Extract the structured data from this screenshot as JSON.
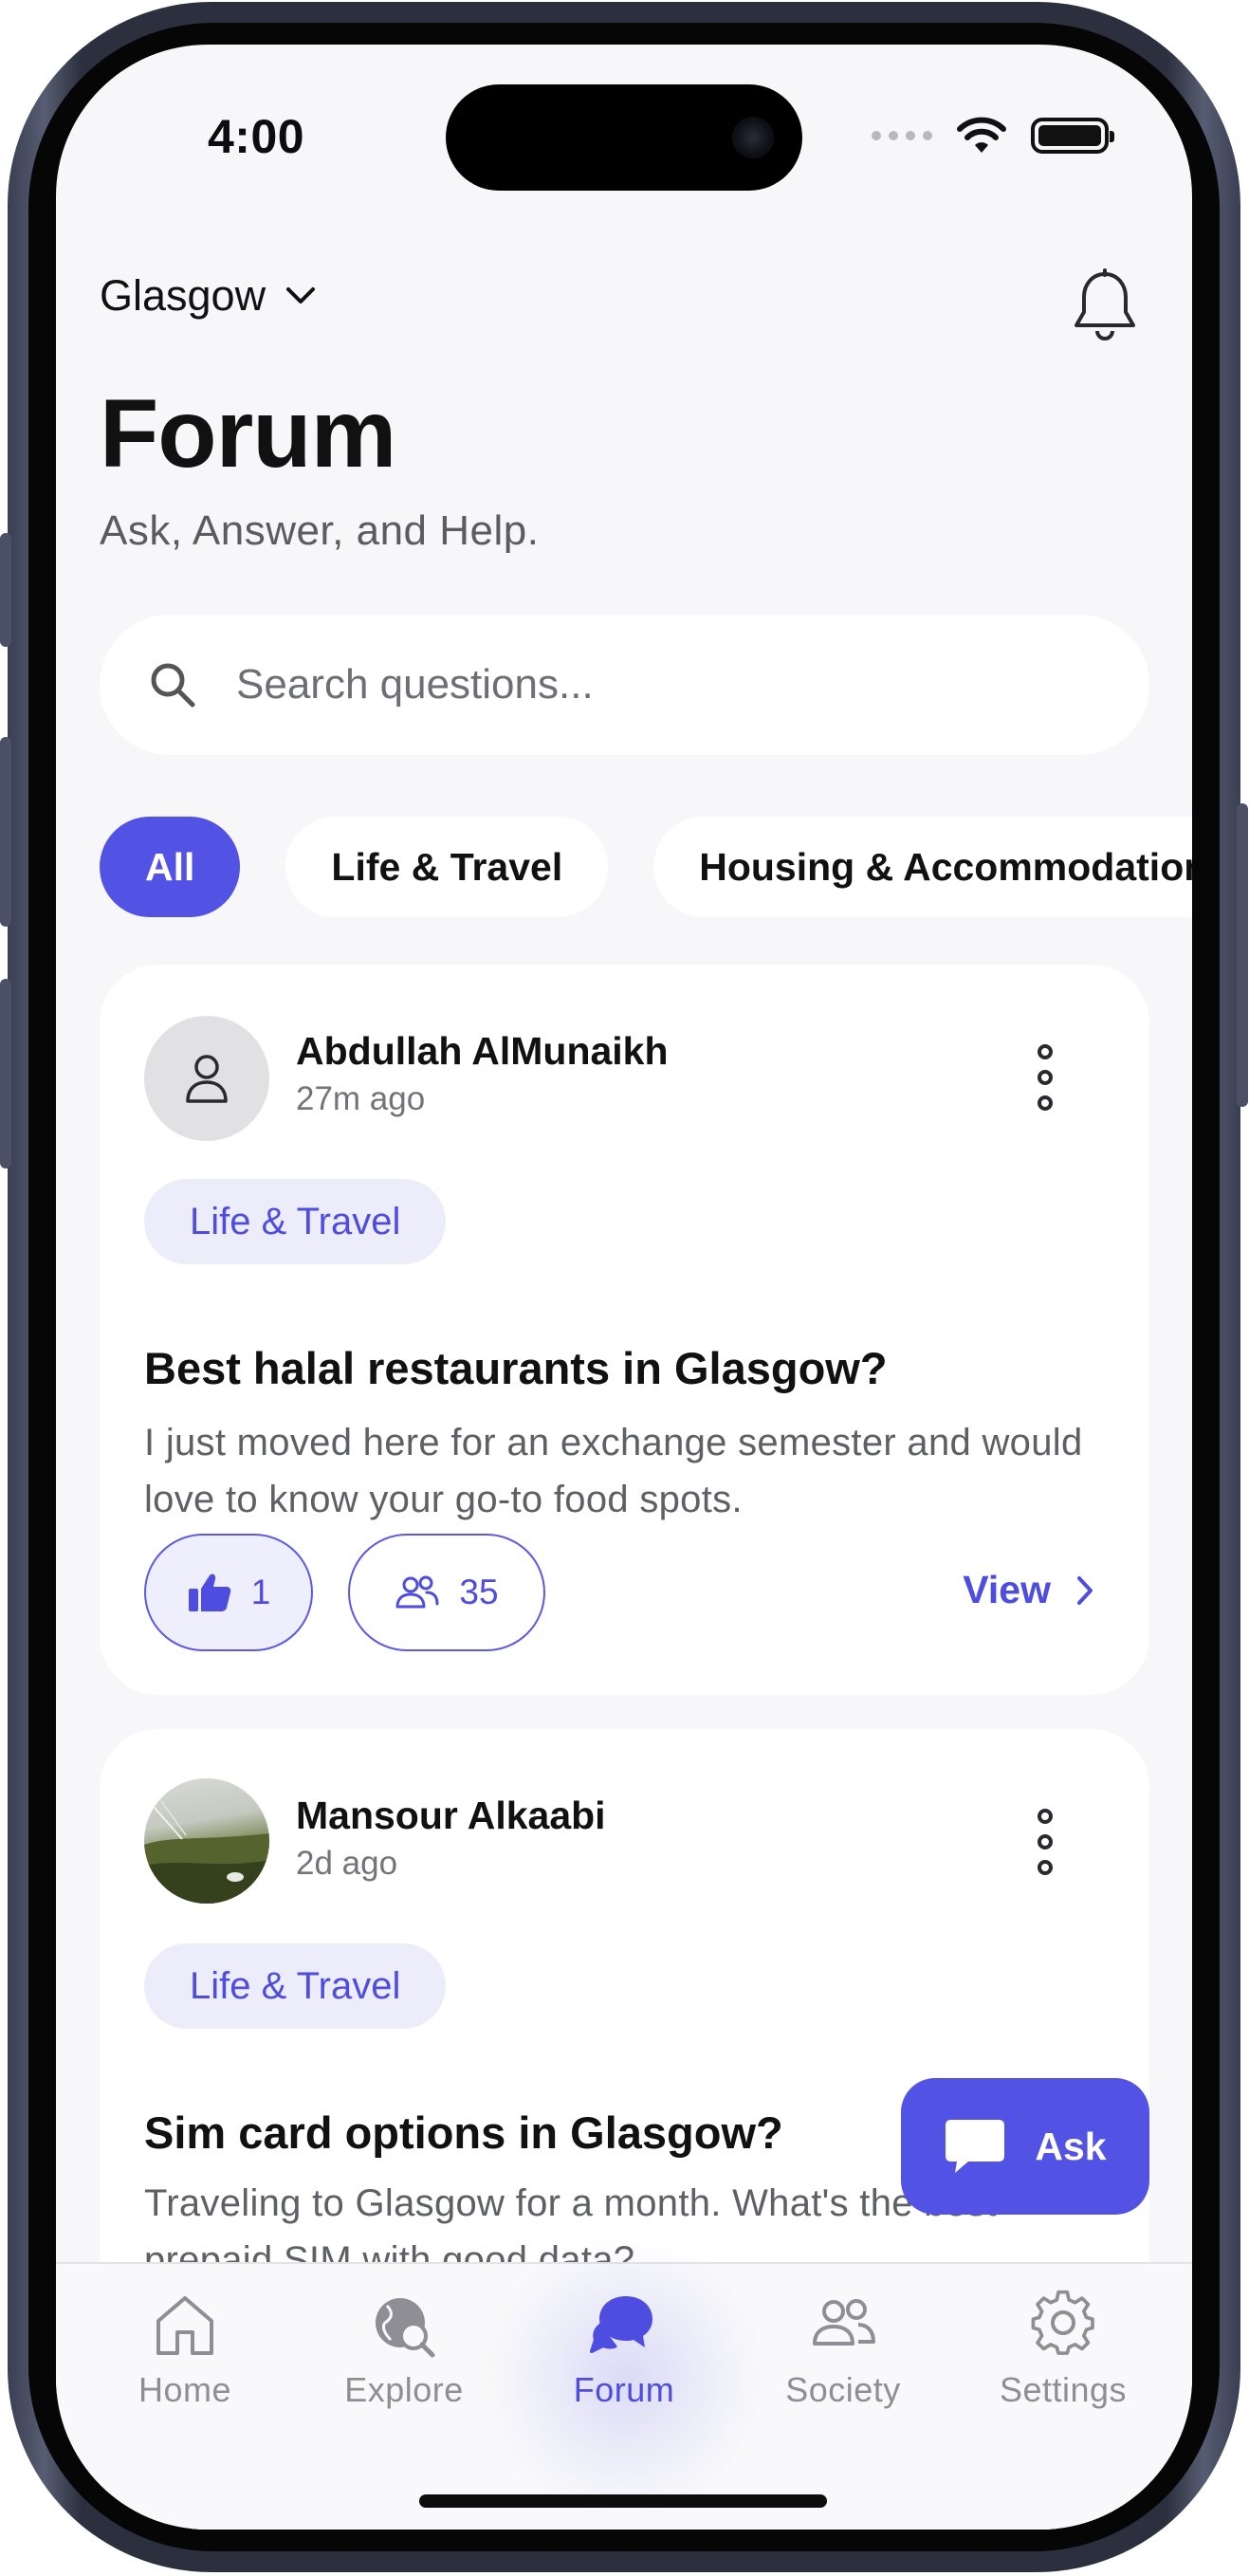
{
  "status_bar": {
    "time": "4:00"
  },
  "header": {
    "city": "Glasgow",
    "title": "Forum",
    "subtitle": "Ask, Answer, and Help."
  },
  "search": {
    "placeholder": "Search questions..."
  },
  "categories": [
    {
      "label": "All",
      "active": true
    },
    {
      "label": "Life & Travel",
      "active": false
    },
    {
      "label": "Housing & Accommodation",
      "active": false
    }
  ],
  "posts": [
    {
      "author": "Abdullah AlMunaikh",
      "time": "27m ago",
      "tag": "Life & Travel",
      "title": "Best halal restaurants in Glasgow?",
      "body": "I just moved here for an exchange semester and would love to know your go-to food spots.",
      "likes": "1",
      "participants": "35",
      "view_label": "View"
    },
    {
      "author": "Mansour Alkaabi",
      "time": "2d ago",
      "tag": "Life & Travel",
      "title": "Sim card options in Glasgow?",
      "body": "Traveling to Glasgow for a month. What's the best prepaid SIM with good data?"
    }
  ],
  "fab": {
    "label": "Ask"
  },
  "tabbar": {
    "items": [
      {
        "label": "Home",
        "icon": "home-icon"
      },
      {
        "label": "Explore",
        "icon": "globe-search-icon"
      },
      {
        "label": "Forum",
        "icon": "chat-bubbles-icon",
        "active": true
      },
      {
        "label": "Society",
        "icon": "people-icon"
      },
      {
        "label": "Settings",
        "icon": "gear-icon"
      }
    ]
  },
  "colors": {
    "accent": "#5252e5",
    "background": "#f7f7f9",
    "tag_background": "#ececfb"
  }
}
